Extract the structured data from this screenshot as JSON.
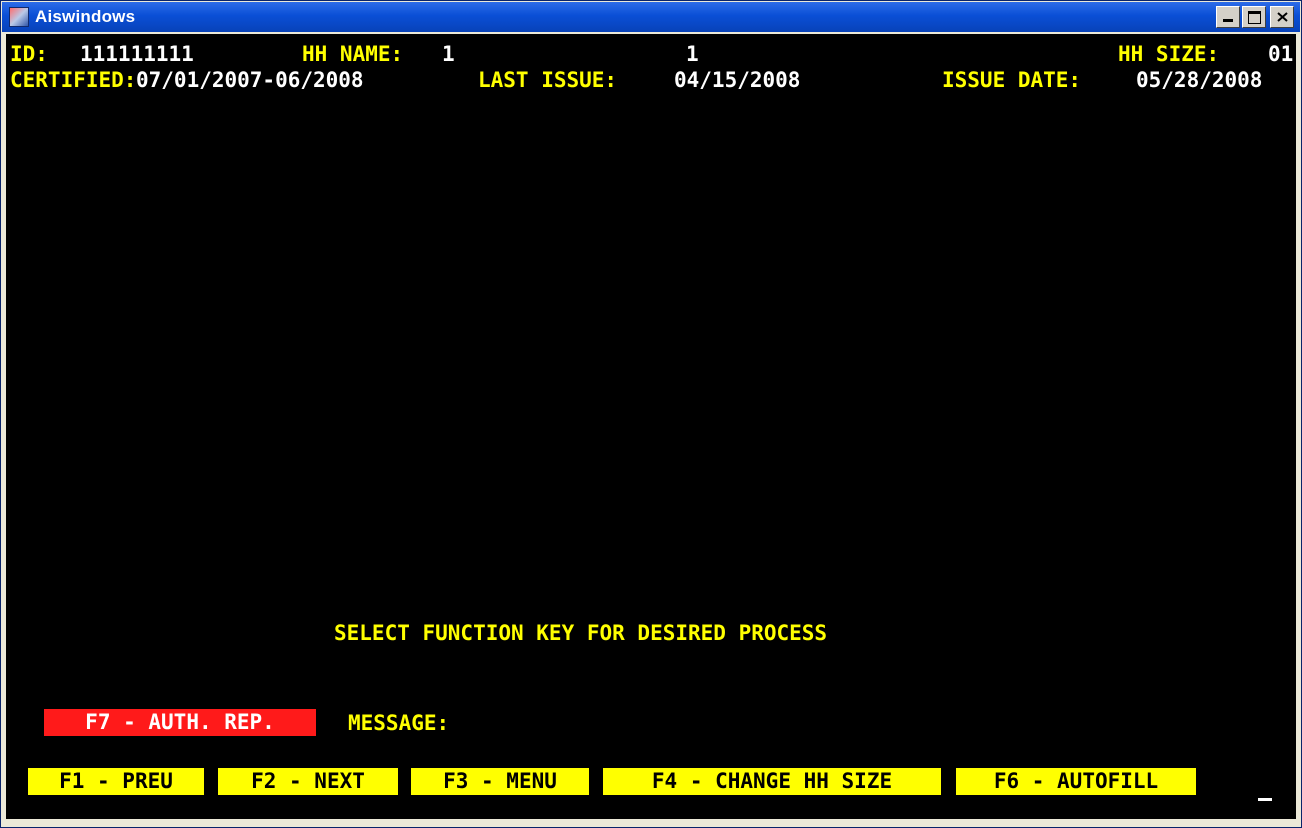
{
  "window": {
    "title": "Aiswindows"
  },
  "header": {
    "id_label": "ID:",
    "id_value": "111111111",
    "hh_name_label": "HH NAME:",
    "hh_name_value": "1",
    "hh_name_value2": "1",
    "hh_size_label": "HH SIZE:",
    "hh_size_value": "01",
    "certified_label": "CERTIFIED:",
    "certified_value": "07/01/2007-06/2008",
    "last_issue_label": "LAST ISSUE:",
    "last_issue_value": "04/15/2008",
    "issue_date_label": "ISSUE DATE:",
    "issue_date_value": "05/28/2008"
  },
  "prompt": "SELECT FUNCTION KEY FOR DESIRED PROCESS",
  "auth_rep_key": "F7 - AUTH. REP.",
  "message_label": "MESSAGE:",
  "function_keys": [
    "F1 - PREU",
    "F2 - NEXT",
    "F3 - MENU",
    "F4 - CHANGE HH SIZE",
    "F6 - AUTOFILL"
  ],
  "colors": {
    "terminal_bg": "#000000",
    "text": "#ffff00",
    "key_bg": "#ffff00",
    "auth_key_bg": "#ff1a1a"
  }
}
